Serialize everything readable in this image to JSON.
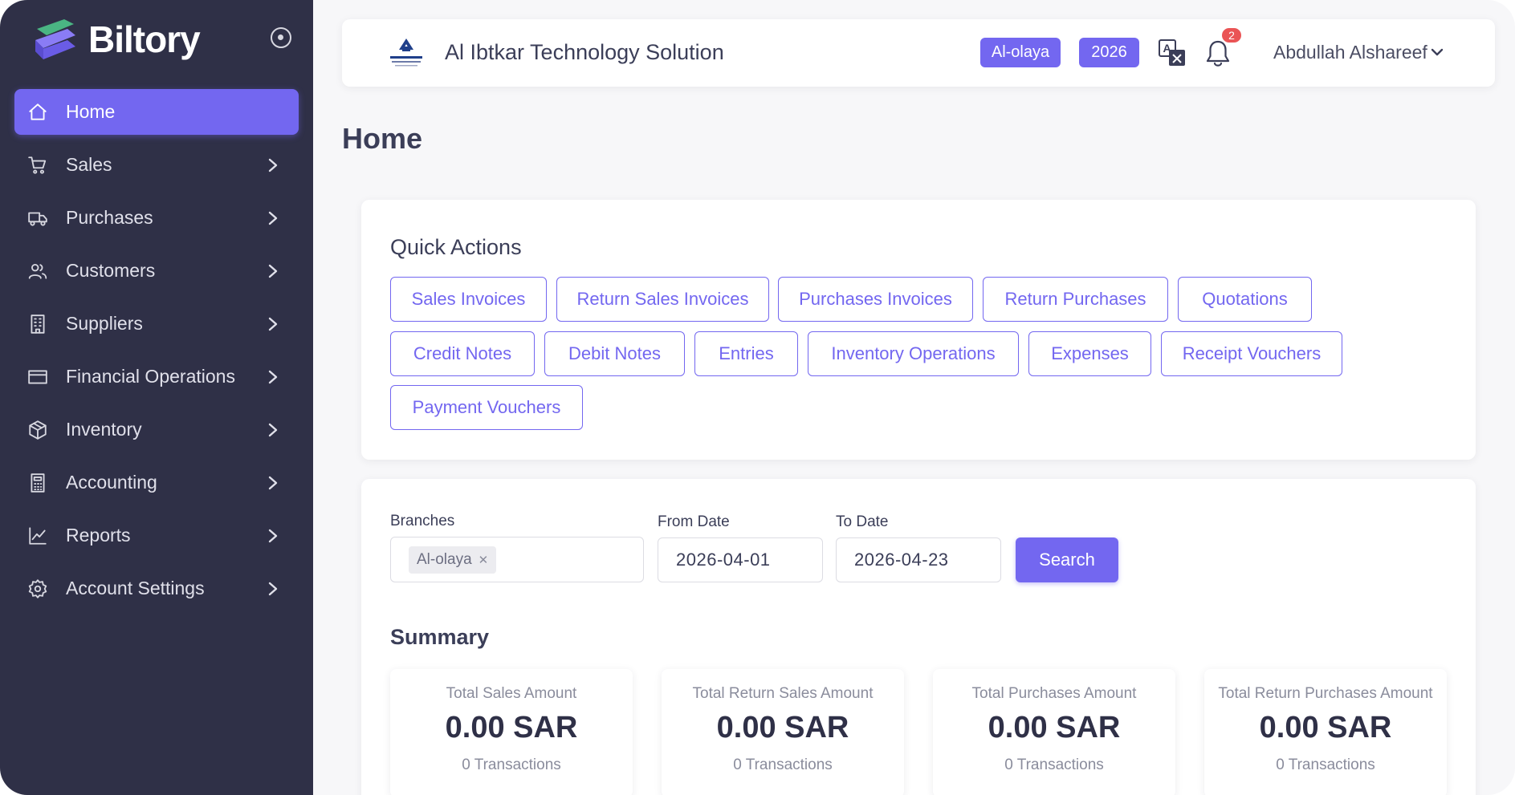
{
  "brand": {
    "name": "Biltory"
  },
  "sidebar": {
    "items": [
      {
        "label": "Home",
        "icon": "home-icon",
        "active": true
      },
      {
        "label": "Sales",
        "icon": "cart-icon"
      },
      {
        "label": "Purchases",
        "icon": "truck-icon"
      },
      {
        "label": "Customers",
        "icon": "users-icon"
      },
      {
        "label": "Suppliers",
        "icon": "building-icon"
      },
      {
        "label": "Financial Operations",
        "icon": "wallet-icon"
      },
      {
        "label": "Inventory",
        "icon": "box-icon"
      },
      {
        "label": "Accounting",
        "icon": "calculator-icon"
      },
      {
        "label": "Reports",
        "icon": "chart-line-icon"
      },
      {
        "label": "Account Settings",
        "icon": "gear-icon"
      }
    ]
  },
  "header": {
    "company": "Al Ibtkar Technology Solution",
    "branch_chip": "Al-olaya",
    "year_chip": "2026",
    "notifications": "2",
    "user": "Abdullah Alshareef"
  },
  "page": {
    "title": "Home"
  },
  "quick_actions": {
    "title": "Quick Actions",
    "buttons": [
      "Sales Invoices",
      "Return Sales Invoices",
      "Purchases Invoices",
      "Return Purchases",
      "Quotations",
      "Credit Notes",
      "Debit Notes",
      "Entries",
      "Inventory Operations",
      "Expenses",
      "Receipt Vouchers",
      "Payment Vouchers"
    ]
  },
  "filters": {
    "branches_label": "Branches",
    "branch_tag": "Al-olaya",
    "from_label": "From Date",
    "from_value": "2026-04-01",
    "to_label": "To Date",
    "to_value": "2026-04-23",
    "search_label": "Search"
  },
  "summary": {
    "title": "Summary",
    "cards": [
      {
        "label": "Total Sales Amount",
        "value": "0.00 SAR",
        "sub": "0 Transactions"
      },
      {
        "label": "Total Return Sales Amount",
        "value": "0.00 SAR",
        "sub": "0 Transactions"
      },
      {
        "label": "Total Purchases Amount",
        "value": "0.00 SAR",
        "sub": "0 Transactions"
      },
      {
        "label": "Total Return Purchases Amount",
        "value": "0.00 SAR",
        "sub": "0 Transactions"
      }
    ]
  },
  "colors": {
    "primary": "#7367f0",
    "sidebar": "#2f3047",
    "danger": "#ea5455"
  }
}
